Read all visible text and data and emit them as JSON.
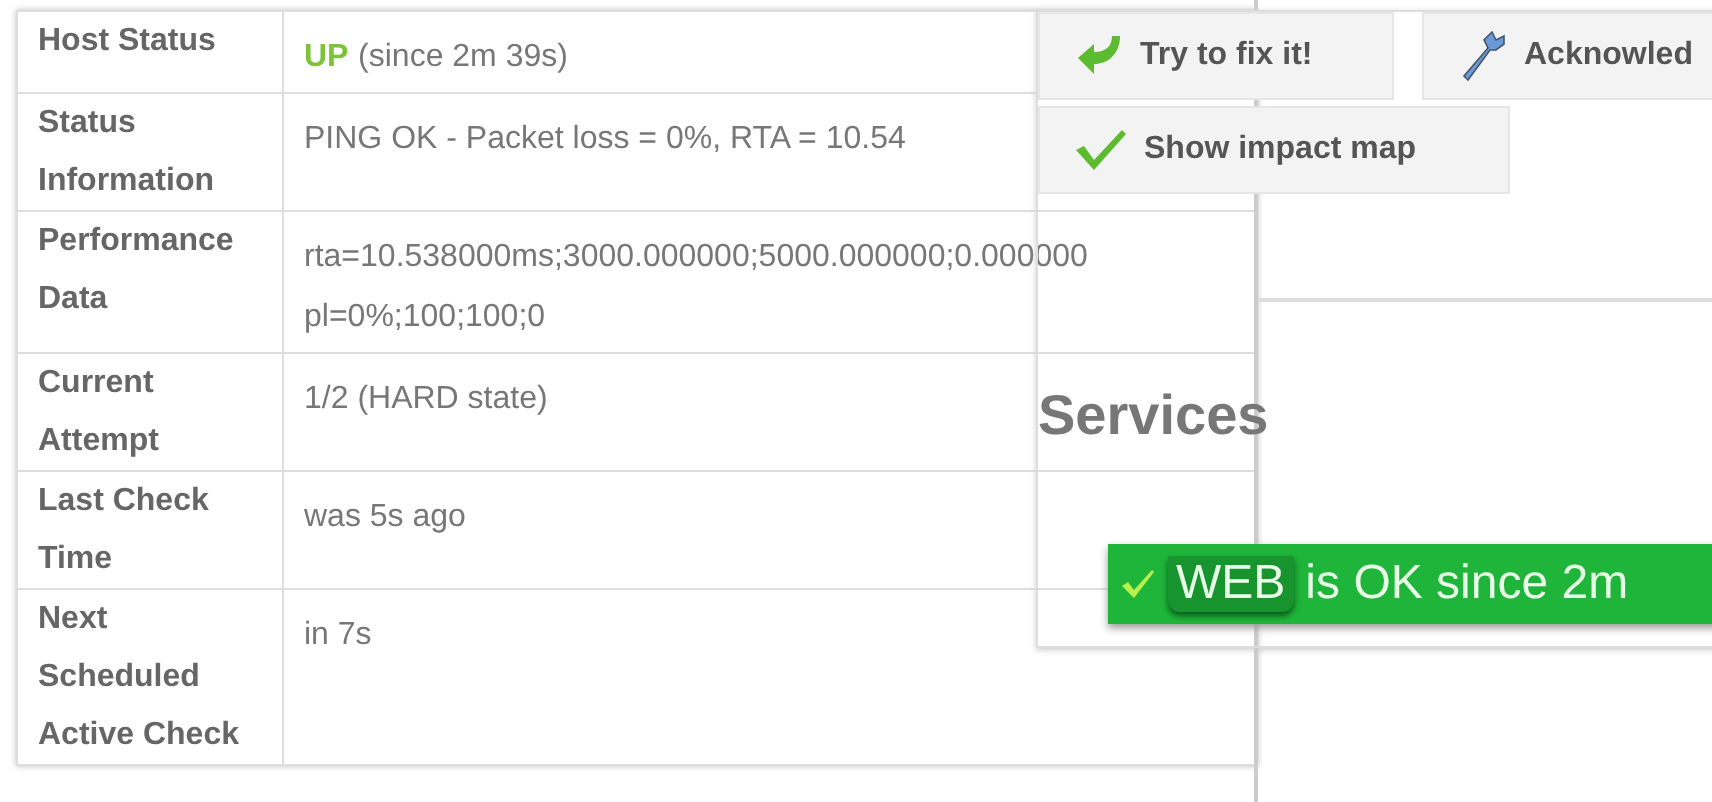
{
  "host_table": {
    "rows": [
      {
        "label": "Host Status",
        "state": "UP",
        "lines": [
          "(since 2m 39s)"
        ]
      },
      {
        "label": "Status Information",
        "lines": [
          "PING OK - Packet loss = 0%, RTA = 10.54"
        ]
      },
      {
        "label": "Performance Data",
        "lines": [
          "rta=10.538000ms;3000.000000;5000.000000;0.000000",
          "pl=0%;100;100;0"
        ]
      },
      {
        "label": "Current Attempt",
        "lines": [
          "1/2 (HARD state)"
        ]
      },
      {
        "label": "Last Check Time",
        "lines": [
          "was 5s ago"
        ]
      },
      {
        "label": "Next Scheduled Active Check",
        "lines": [
          "in 7s"
        ]
      }
    ]
  },
  "actions": [
    {
      "kind": "fix",
      "label": "Try to fix it!"
    },
    {
      "kind": "acknowledge",
      "label": "Acknowled"
    },
    {
      "kind": "impact",
      "label": "Show impact map"
    }
  ],
  "services": {
    "title": "Services",
    "items": [
      {
        "name": "WEB",
        "verb": "is",
        "state": "OK",
        "since": "since 2m"
      }
    ]
  }
}
